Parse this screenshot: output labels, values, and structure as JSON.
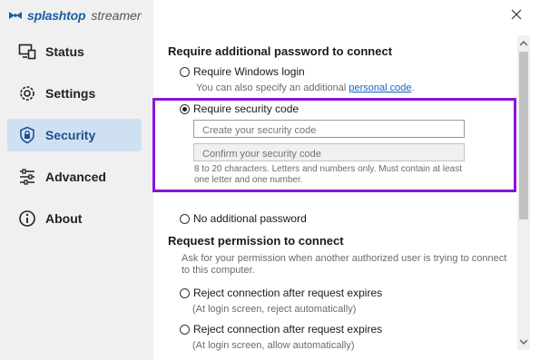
{
  "app": {
    "brand": "splashtop",
    "product": "streamer"
  },
  "colors": {
    "accent": "#1565c0",
    "highlight": "#8b13d8",
    "active_nav_bg": "#cfe0f3"
  },
  "sidebar": {
    "items": [
      {
        "label": "Status",
        "icon": "monitor-icon",
        "active": false
      },
      {
        "label": "Settings",
        "icon": "gear-icon",
        "active": false
      },
      {
        "label": "Security",
        "icon": "shield-lock-icon",
        "active": true
      },
      {
        "label": "Advanced",
        "icon": "sliders-icon",
        "active": false
      },
      {
        "label": "About",
        "icon": "info-icon",
        "active": false
      }
    ]
  },
  "password_section": {
    "title": "Require additional password to connect",
    "windows_login": {
      "label": "Require Windows login",
      "note_prefix": "You can also specify an additional",
      "note_link": "personal code",
      "note_suffix": "."
    },
    "security_code": {
      "label": "Require security code",
      "checked": true,
      "create_placeholder": "Create your security code",
      "confirm_placeholder": "Confirm your security code",
      "hint": "8 to 20 characters. Letters and numbers only. Must contain at least one letter and one number."
    },
    "no_password": {
      "label": "No additional password"
    }
  },
  "permission_section": {
    "title": "Request permission to connect",
    "description": "Ask for your permission when another authorized user is trying to connect to this computer.",
    "options": [
      {
        "label": "Reject connection after request expires",
        "note": "(At login screen, reject automatically)"
      },
      {
        "label": "Reject connection after request expires",
        "note": "(At login screen, allow automatically)"
      }
    ]
  }
}
